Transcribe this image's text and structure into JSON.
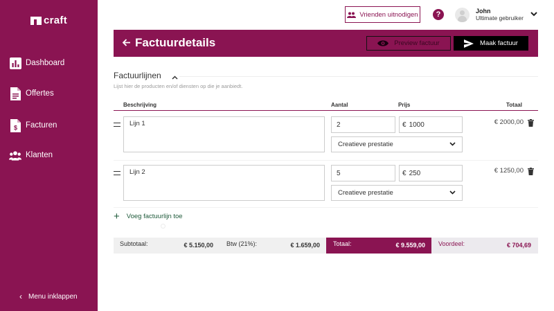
{
  "brand": {
    "name": "craft"
  },
  "sidebar": {
    "items": [
      {
        "label": "Dashboard",
        "icon": "chart-icon"
      },
      {
        "label": "Offertes",
        "icon": "document-icon"
      },
      {
        "label": "Facturen",
        "icon": "invoice-icon"
      },
      {
        "label": "Klanten",
        "icon": "users-icon"
      }
    ],
    "collapse_label": "Menu inklappen"
  },
  "topbar": {
    "invite_label": "Vrienden uitnodigen",
    "help_icon": "question-icon",
    "user_name": "John",
    "user_role": "Ultimate gebruiker"
  },
  "header": {
    "title": "Factuurdetails",
    "preview_label": "Preview factuur",
    "make_label": "Maak factuur"
  },
  "section": {
    "title": "Factuurlijnen",
    "subtitle": "Lijst hier de producten en/of diensten op die je aanbiedt."
  },
  "table": {
    "headers": {
      "description": "Beschrijving",
      "quantity": "Aantal",
      "price": "Prijs",
      "total": "Totaal"
    },
    "rows": [
      {
        "description": "Lijn 1",
        "quantity": "2",
        "currency": "€",
        "price": "1000",
        "category": "Creatieve prestatie",
        "total": "€ 2000,00"
      },
      {
        "description": "Lijn 2",
        "quantity": "5",
        "currency": "€",
        "price": "250",
        "category": "Creatieve prestatie",
        "total": "€ 1250,00"
      }
    ],
    "add_label": "Voeg factuurlijn toe"
  },
  "totals": {
    "subtotal_label": "Subtotaal:",
    "subtotal_value": "€ 5.150,00",
    "vat_label": "Btw (21%):",
    "vat_value": "€ 1.659,00",
    "total_label": "Totaal:",
    "total_value": "€ 9.559,00",
    "advantage_label": "Voordeel:",
    "advantage_value": "€ 704,69"
  },
  "colors": {
    "brand": "#8a1452",
    "accent_green": "#1e5a3a"
  }
}
